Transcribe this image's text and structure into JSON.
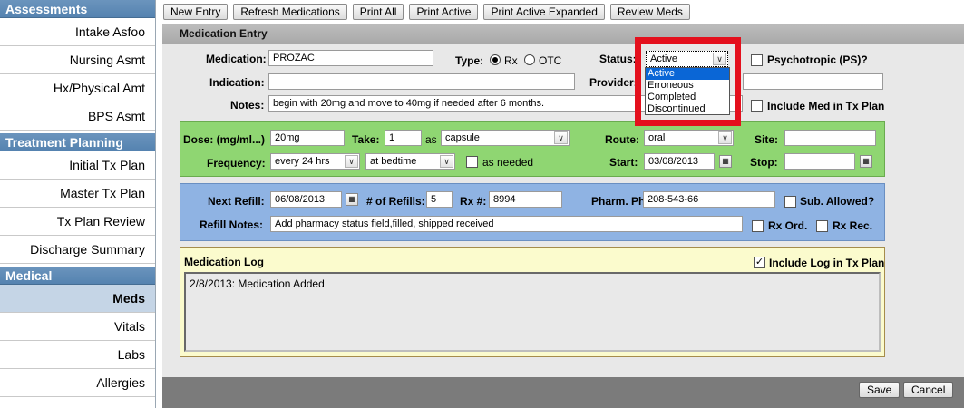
{
  "sidebar": {
    "sections": [
      {
        "title": "Assessments",
        "items": [
          "Intake Asfoo",
          "Nursing Asmt",
          "Hx/Physical Amt",
          "BPS Asmt"
        ]
      },
      {
        "title": "Treatment Planning",
        "items": [
          "Initial Tx Plan",
          "Master Tx Plan",
          "Tx Plan Review",
          "Discharge Summary"
        ]
      },
      {
        "title": "Medical",
        "items": [
          "Meds",
          "Vitals",
          "Labs",
          "Allergies"
        ]
      }
    ],
    "active_item": "Meds"
  },
  "toolbar": {
    "buttons": [
      "New Entry",
      "Refresh Medications",
      "Print All",
      "Print Active",
      "Print Active Expanded",
      "Review Meds"
    ]
  },
  "main": {
    "title": "Medication Entry",
    "medication_label": "Medication:",
    "medication_value": "PROZAC",
    "type_label": "Type:",
    "type_rx": "Rx",
    "type_otc": "OTC",
    "type_selected": "Rx",
    "status_label": "Status:",
    "status_value": "Active",
    "status_options": [
      "Active",
      "Erroneous",
      "Completed",
      "Discontinued"
    ],
    "psychotropic_label": "Psychotropic (PS)?",
    "indication_label": "Indication:",
    "indication_value": "",
    "provider_label": "Provider:",
    "provider_value": "",
    "notes_label": "Notes:",
    "notes_value": "begin with 20mg and move to 40mg if needed after 6 months.",
    "include_med_label": "Include Med in Tx Plan"
  },
  "dose": {
    "dose_label": "Dose: (mg/ml...)",
    "dose_value": "20mg",
    "take_label": "Take:",
    "take_value": "1",
    "as_label": "as",
    "as_value": "capsule",
    "route_label": "Route:",
    "route_value": "oral",
    "site_label": "Site:",
    "site_value": "",
    "frequency_label": "Frequency:",
    "frequency_value": "every 24 hrs",
    "frequency_when": "at bedtime",
    "as_needed_label": "as needed",
    "start_label": "Start:",
    "start_value": "03/08/2013",
    "stop_label": "Stop:",
    "stop_value": ""
  },
  "refill": {
    "next_refill_label": "Next Refill:",
    "next_refill_value": "06/08/2013",
    "num_refills_label": "# of Refills:",
    "num_refills_value": "5",
    "rx_num_label": "Rx #:",
    "rx_num_value": "8994",
    "pharm_ph_label": "Pharm. Ph:",
    "pharm_ph_value": "208-543-66",
    "sub_allowed_label": "Sub. Allowed?",
    "refill_notes_label": "Refill Notes:",
    "refill_notes_value": "Add pharmacy status field,filled, shipped received",
    "rx_ord_label": "Rx Ord.",
    "rx_rec_label": "Rx Rec."
  },
  "log": {
    "title": "Medication Log",
    "include_label": "Include Log in Tx Plan",
    "include_checked": true,
    "entry": "2/8/2013: Medication Added"
  },
  "footer": {
    "save_label": "Save",
    "cancel_label": "Cancel"
  },
  "colors": {
    "sidebar_header": "#5b89b6",
    "dose_panel": "#8fd672",
    "refill_panel": "#8fb3e3",
    "log_panel": "#fbfbcd",
    "highlight": "#e4101d",
    "selected_option": "#0a66d6"
  }
}
